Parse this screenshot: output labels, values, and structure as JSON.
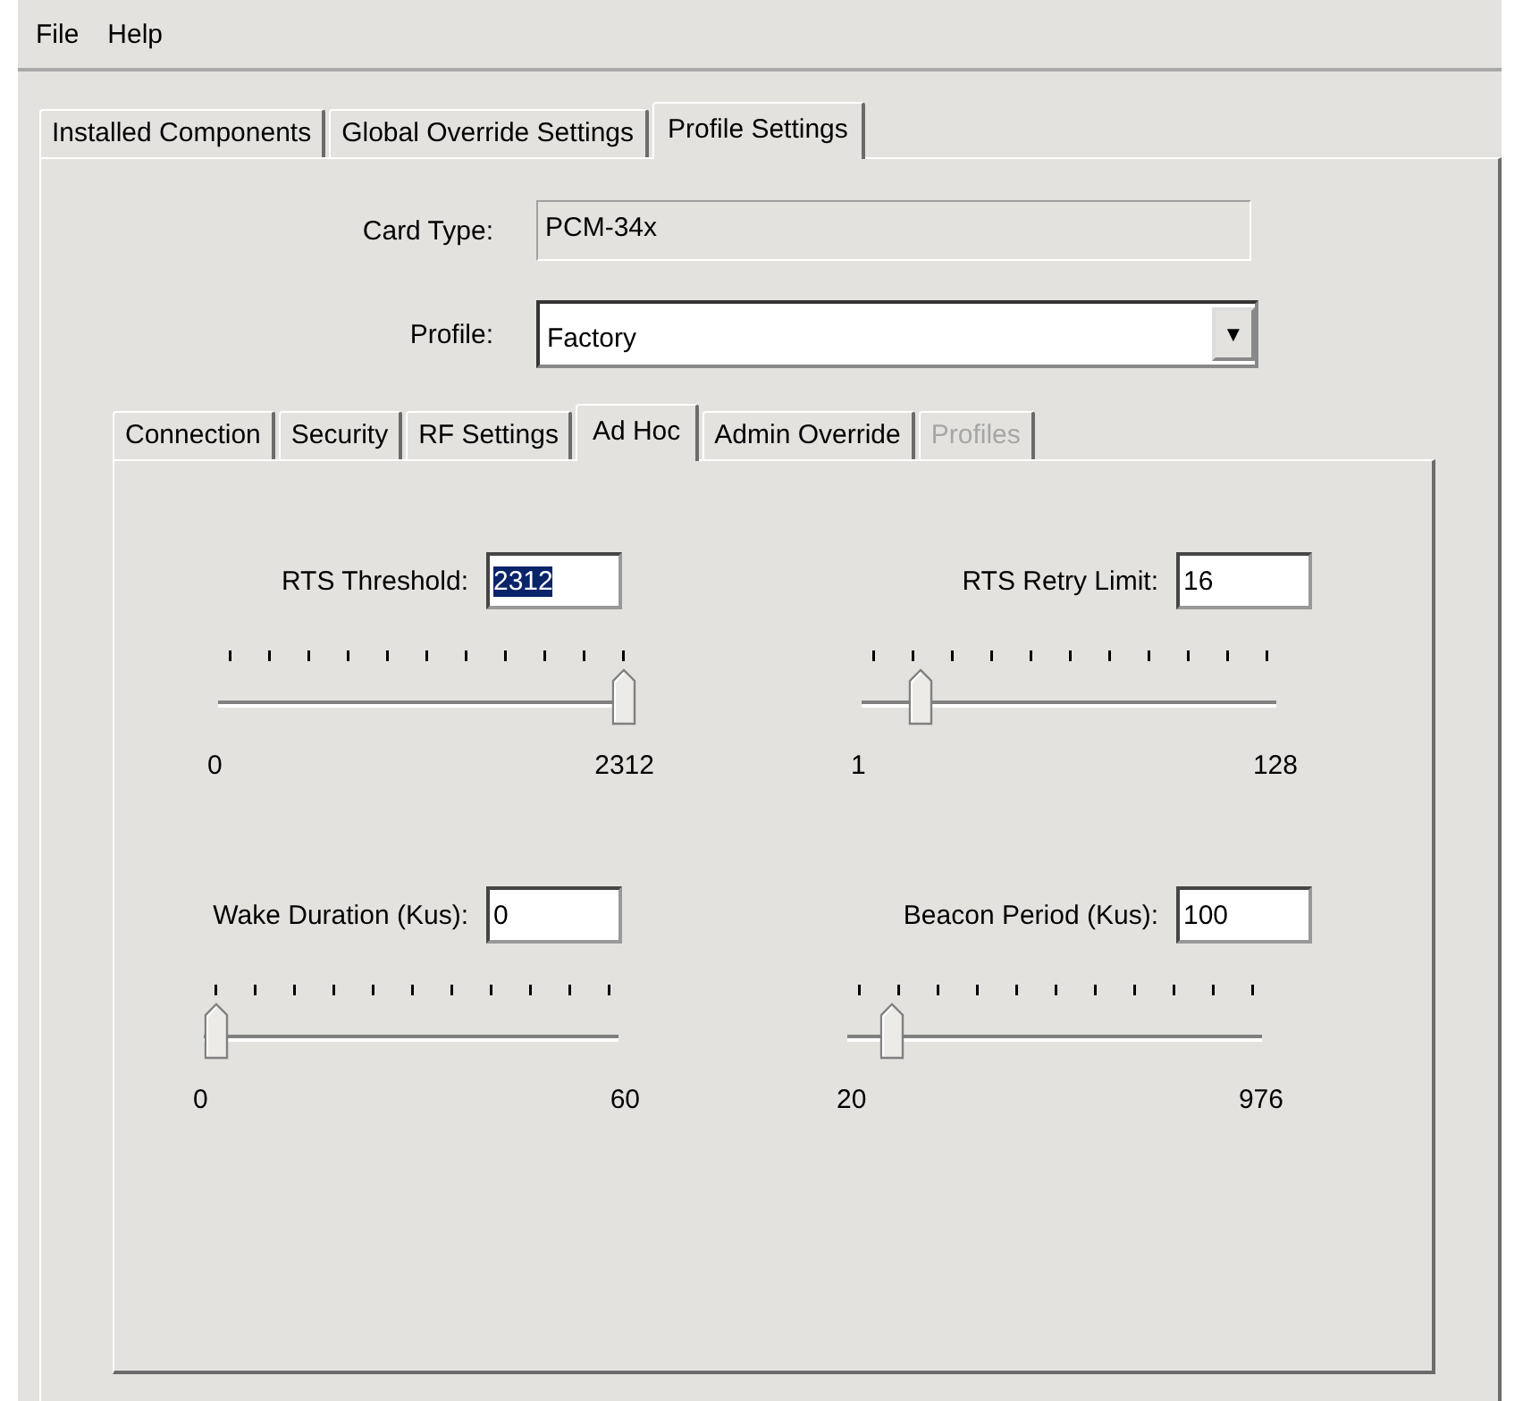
{
  "menu": [
    "File",
    "Help"
  ],
  "tabs": [
    {
      "label": "Installed Components",
      "selected": false
    },
    {
      "label": "Global Override Settings",
      "selected": false
    },
    {
      "label": "Profile Settings",
      "selected": true
    }
  ],
  "card_type": {
    "label": "Card Type:",
    "value": "PCM-34x"
  },
  "profile": {
    "label": "Profile:",
    "value": "Factory",
    "arrow": "▼"
  },
  "sub_tabs": [
    {
      "label": "Connection",
      "selected": false,
      "disabled": false
    },
    {
      "label": "Security",
      "selected": false,
      "disabled": false
    },
    {
      "label": "RF Settings",
      "selected": false,
      "disabled": false
    },
    {
      "label": "Ad Hoc",
      "selected": true,
      "disabled": false
    },
    {
      "label": "Admin Override",
      "selected": false,
      "disabled": false
    },
    {
      "label": "Profiles",
      "selected": false,
      "disabled": true
    }
  ],
  "settings": [
    {
      "label": "RTS Threshold:",
      "value": "2312",
      "text_selected": true,
      "level": 1.0,
      "min": "0",
      "max": "2312"
    },
    {
      "label": "RTS Retry Limit:",
      "value": "16",
      "text_selected": false,
      "level": 0.12,
      "min": "1",
      "max": "128"
    },
    {
      "label": "Wake Duration (Kus):",
      "value": "0",
      "text_selected": false,
      "level": 0.0,
      "min": "0",
      "max": "60"
    },
    {
      "label": "Beacon Period (Kus):",
      "value": "100",
      "text_selected": false,
      "level": 0.08,
      "min": "20",
      "max": "976"
    }
  ]
}
